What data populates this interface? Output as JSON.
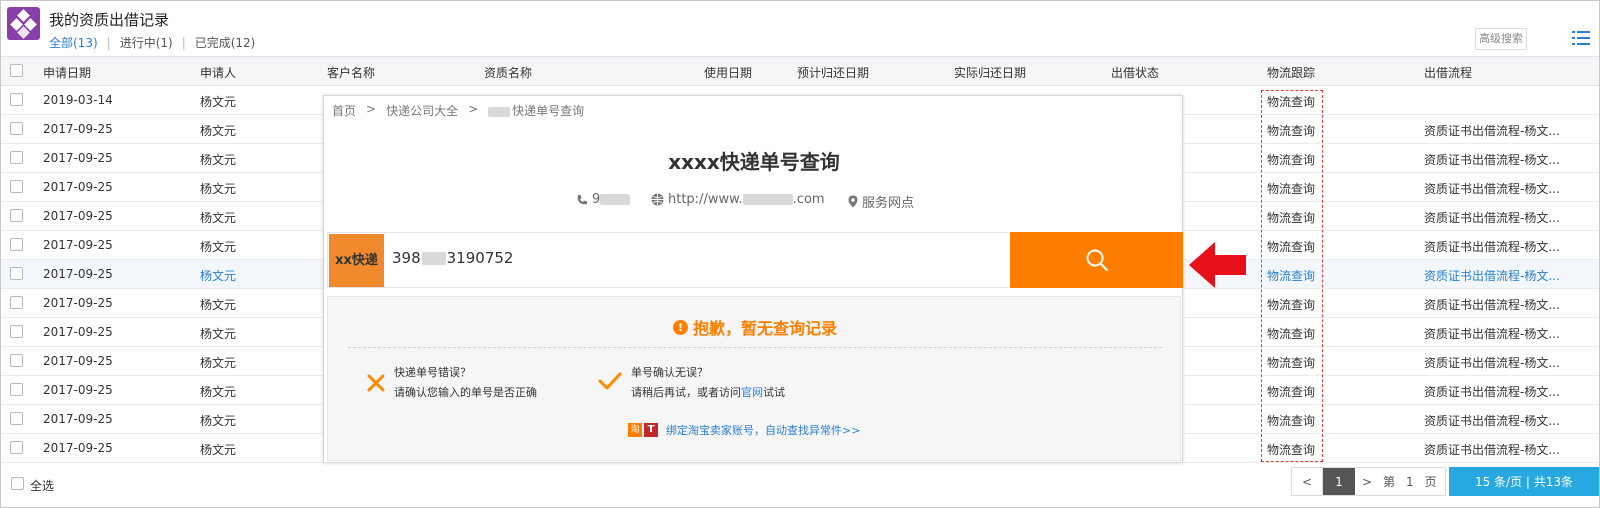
{
  "header": {
    "title": "我的资质出借记录",
    "filters": [
      {
        "label": "全部(13)",
        "active": true
      },
      {
        "label": "进行中(1)",
        "active": false
      },
      {
        "label": "已完成(12)",
        "active": false
      }
    ],
    "advanced_search": "高级搜索"
  },
  "table": {
    "columns": [
      "申请日期",
      "申请人",
      "客户名称",
      "资质名称",
      "使用日期",
      "预计归还日期",
      "实际归还日期",
      "出借状态",
      "物流跟踪",
      "出借流程"
    ],
    "rows": [
      {
        "date": "2019-03-14",
        "applicant": "杨文元",
        "logistics": "物流查询",
        "process": ""
      },
      {
        "date": "2017-09-25",
        "applicant": "杨文元",
        "logistics": "物流查询",
        "process": "资质证书出借流程-杨文..."
      },
      {
        "date": "2017-09-25",
        "applicant": "杨文元",
        "logistics": "物流查询",
        "process": "资质证书出借流程-杨文..."
      },
      {
        "date": "2017-09-25",
        "applicant": "杨文元",
        "logistics": "物流查询",
        "process": "资质证书出借流程-杨文..."
      },
      {
        "date": "2017-09-25",
        "applicant": "杨文元",
        "logistics": "物流查询",
        "process": "资质证书出借流程-杨文..."
      },
      {
        "date": "2017-09-25",
        "applicant": "杨文元",
        "logistics": "物流查询",
        "process": "资质证书出借流程-杨文..."
      },
      {
        "date": "2017-09-25",
        "applicant": "杨文元",
        "logistics": "物流查询",
        "process": "资质证书出借流程-杨文...",
        "highlighted": true
      },
      {
        "date": "2017-09-25",
        "applicant": "杨文元",
        "logistics": "物流查询",
        "process": "资质证书出借流程-杨文..."
      },
      {
        "date": "2017-09-25",
        "applicant": "杨文元",
        "logistics": "物流查询",
        "process": "资质证书出借流程-杨文..."
      },
      {
        "date": "2017-09-25",
        "applicant": "杨文元",
        "logistics": "物流查询",
        "process": "资质证书出借流程-杨文..."
      },
      {
        "date": "2017-09-25",
        "applicant": "杨文元",
        "logistics": "物流查询",
        "process": "资质证书出借流程-杨文..."
      },
      {
        "date": "2017-09-25",
        "applicant": "杨文元",
        "logistics": "物流查询",
        "process": "资质证书出借流程-杨文..."
      },
      {
        "date": "2017-09-25",
        "applicant": "杨文元",
        "logistics": "物流查询",
        "process": "资质证书出借流程-杨文..."
      }
    ]
  },
  "overlay": {
    "breadcrumb": [
      "首页",
      ">",
      "快递公司大全",
      ">",
      "快递单号查询"
    ],
    "title": "xxxx快递单号查询",
    "phone_prefix": "9",
    "website_prefix": "http://www.",
    "website_suffix": ".com",
    "service_points": "服务网点",
    "company_logo": "xx快递",
    "tracking_prefix": "398",
    "tracking_suffix": "3190752",
    "result_title": "抱歉，暂无查询记录",
    "tip1_title": "快递单号错误？",
    "tip1_text": "请确认您输入的单号是否正确",
    "tip2_title": "单号确认无误？",
    "tip2_text_a": "请稍后再试，或者访问",
    "tip2_link": "官网",
    "tip2_text_b": "试试",
    "promo_icon1": "淘",
    "promo_icon2": "T",
    "promo_text": "绑定淘宝卖家账号，自动查找异常件>>"
  },
  "footer": {
    "select_all": "全选",
    "prev": "<",
    "current_page": "1",
    "next": ">",
    "page_label_a": "第",
    "page_num": "1",
    "page_label_b": "页",
    "page_size": "15 条/页 | 共13条"
  },
  "colors": {
    "accent_blue": "#2a7fd4",
    "orange": "#ff7e00",
    "red_arrow": "#e8101a",
    "app_icon": "#8a3ea8"
  }
}
